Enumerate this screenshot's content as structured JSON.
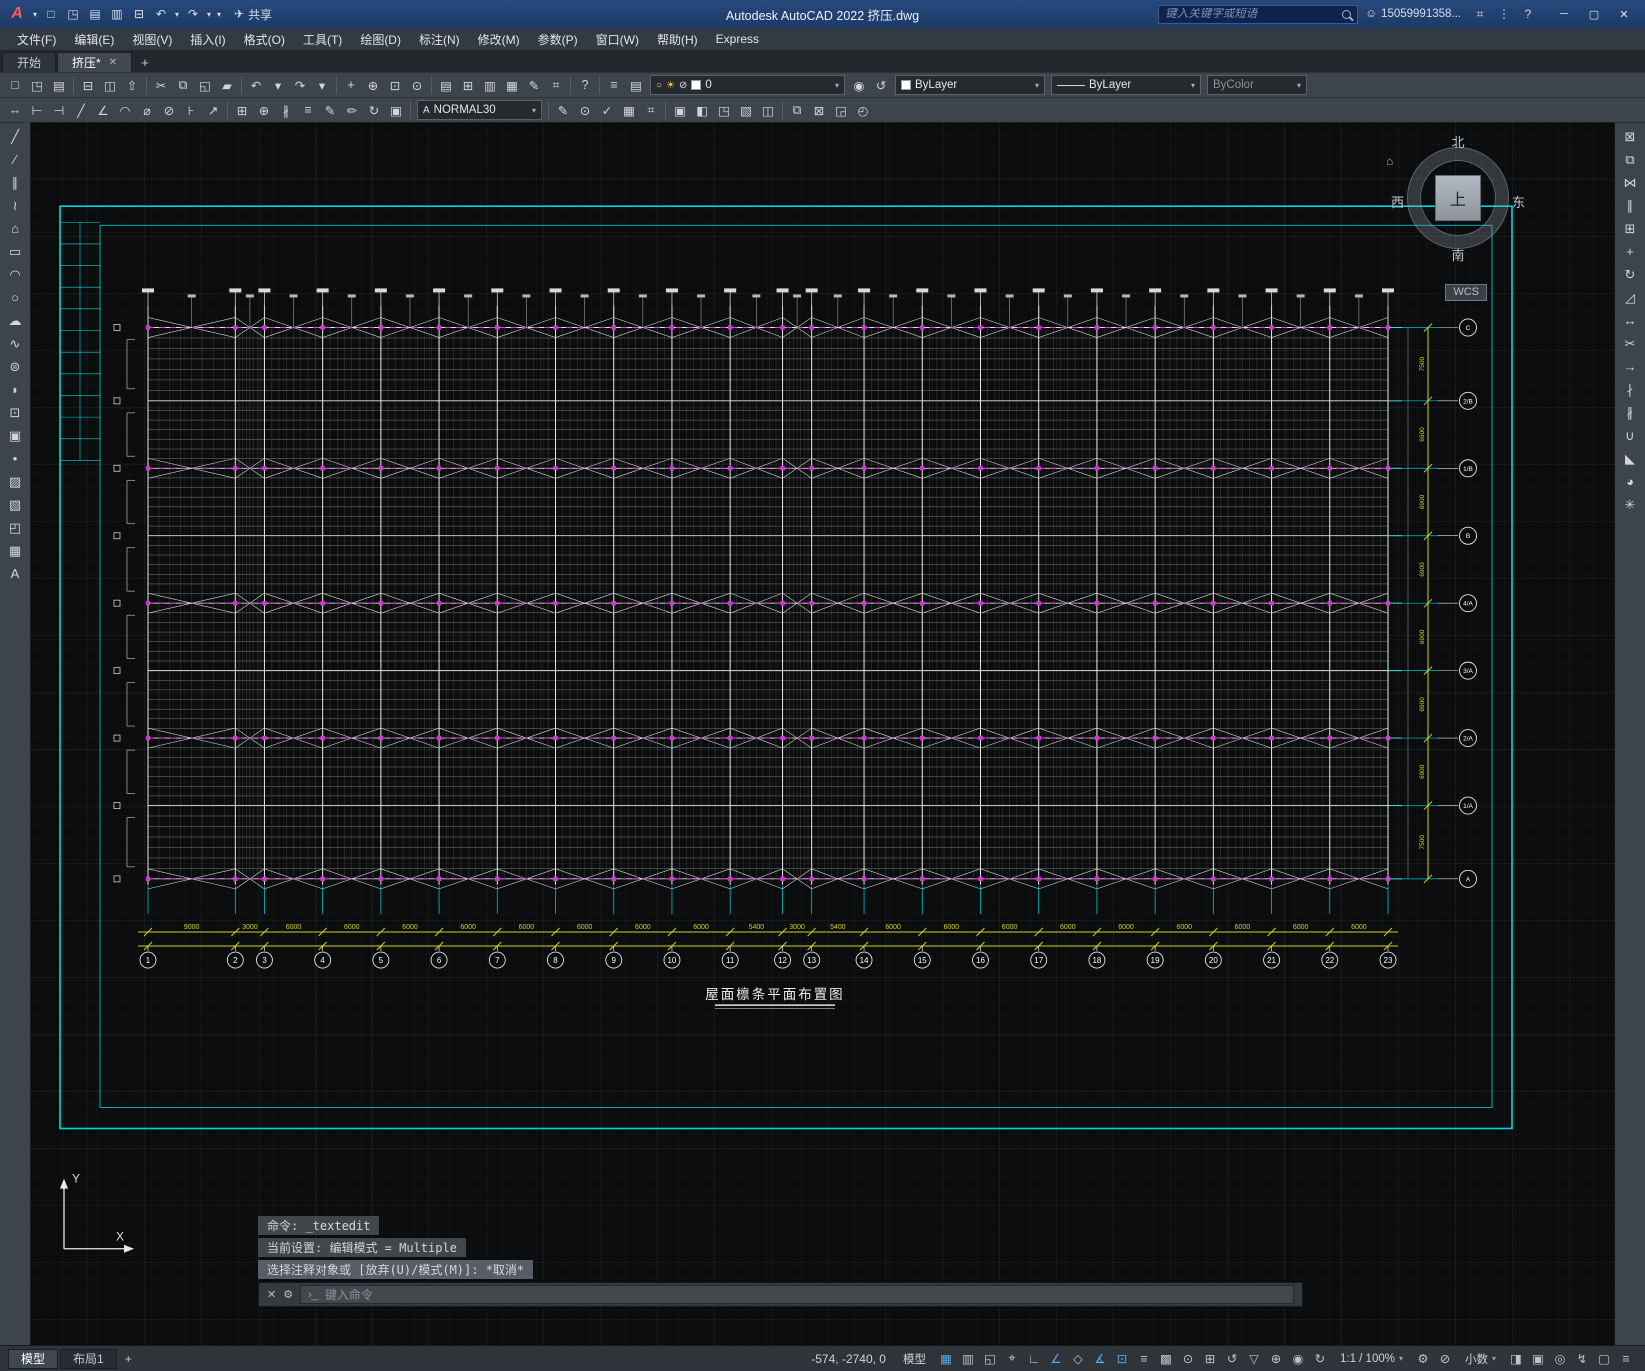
{
  "window": {
    "title": "Autodesk AutoCAD 2022   挤压.dwg",
    "search_placeholder": "键入关键字或短语",
    "user_id": "15059991358...",
    "user_glyph": "☺",
    "share_label": "共享",
    "share_glyph": "✈",
    "min_glyph": "─",
    "max_glyph": "▢",
    "close_glyph": "✕",
    "caret_glyph": "▾"
  },
  "qat": [
    {
      "n": "app-menu-caret-icon",
      "g": "▾",
      "small": 1
    },
    {
      "n": "qnew-icon",
      "g": "□"
    },
    {
      "n": "open-icon",
      "g": "◳"
    },
    {
      "n": "qsave-icon",
      "g": "▤"
    },
    {
      "n": "save-as-icon",
      "g": "▥"
    },
    {
      "n": "plot-icon",
      "g": "⊟"
    },
    {
      "n": "undo-icon",
      "g": "↶"
    },
    {
      "n": "undo-caret-icon",
      "g": "▾",
      "small": 1
    },
    {
      "n": "redo-icon",
      "g": "↷"
    },
    {
      "n": "redo-caret-icon",
      "g": "▾",
      "small": 1
    },
    {
      "n": "qat-customize-caret-icon",
      "g": "▾",
      "small": 1
    }
  ],
  "title_icons": [
    {
      "n": "cart-icon",
      "g": "⌗"
    },
    {
      "n": "apps-grid-icon",
      "g": "⋮"
    },
    {
      "n": "help-icon",
      "g": "?"
    }
  ],
  "menus": [
    "文件(F)",
    "编辑(E)",
    "视图(V)",
    "插入(I)",
    "格式(O)",
    "工具(T)",
    "绘图(D)",
    "标注(N)",
    "修改(M)",
    "参数(P)",
    "窗口(W)",
    "帮助(H)",
    "Express"
  ],
  "tabs": {
    "start": "开始",
    "drawing": "挤压*",
    "close_glyph": "✕",
    "new_glyph": "+"
  },
  "toolbars": {
    "caret": "▾",
    "row1": [
      {
        "n": "qnew-icon",
        "g": "□"
      },
      {
        "n": "open-icon",
        "g": "◳"
      },
      {
        "n": "save-icon",
        "g": "▤"
      },
      {
        "sep": 1
      },
      {
        "n": "plot-icon",
        "g": "⊟"
      },
      {
        "n": "plot-preview-icon",
        "g": "◫"
      },
      {
        "n": "publish-icon",
        "g": "⇧"
      },
      {
        "sep": 1
      },
      {
        "n": "cut-icon",
        "g": "✂"
      },
      {
        "n": "copy-icon",
        "g": "⧉"
      },
      {
        "n": "paste-icon",
        "g": "◱"
      },
      {
        "n": "match-properties-icon",
        "g": "▰"
      },
      {
        "sep": 1
      },
      {
        "n": "undo-icon",
        "g": "↶"
      },
      {
        "n": "undo-caret-icon",
        "g": "▾",
        "small": 1
      },
      {
        "n": "redo-icon",
        "g": "↷"
      },
      {
        "n": "redo-caret-icon",
        "g": "▾",
        "small": 1
      },
      {
        "sep": 1
      },
      {
        "n": "pan-icon",
        "g": "+"
      },
      {
        "n": "zoom-realtime-icon",
        "g": "⊕"
      },
      {
        "n": "zoom-window-icon",
        "g": "⊡"
      },
      {
        "n": "zoom-previous-icon",
        "g": "⊙"
      },
      {
        "sep": 1
      },
      {
        "n": "properties-icon",
        "g": "▤"
      },
      {
        "n": "designcenter-icon",
        "g": "⊞"
      },
      {
        "n": "tool-palettes-icon",
        "g": "▥"
      },
      {
        "n": "sheet-set-manager-icon",
        "g": "▦"
      },
      {
        "n": "markup-import-icon",
        "g": "✎"
      },
      {
        "n": "quick-calc-icon",
        "g": "⌗"
      },
      {
        "sep": 1
      },
      {
        "n": "help-icon",
        "g": "?"
      },
      {
        "sep": 1
      }
    ],
    "row1_layer_icons": [
      {
        "n": "layer-properties-icon",
        "g": "≡"
      },
      {
        "n": "layer-states-icon",
        "g": "▤"
      }
    ],
    "layer_combo": {
      "bulb": "○",
      "sun": "☀",
      "lock": "⊘",
      "value": "0"
    },
    "row1_layer_after": [
      {
        "n": "make-layer-current-icon",
        "g": "◉"
      },
      {
        "n": "layer-previous-icon",
        "g": "↺"
      }
    ],
    "color_value": "ByLayer",
    "linetype_value": "ByLayer",
    "plot_style": "ByColor",
    "text_style": "NORMAL30",
    "text_style_icon": "A",
    "row2a": [
      {
        "n": "measure-icon",
        "g": "↔"
      },
      {
        "n": "quick-dimension-icon",
        "g": "⊢"
      },
      {
        "n": "linear-dimension-icon",
        "g": "⊣"
      },
      {
        "n": "aligned-dimension-icon",
        "g": "╱"
      },
      {
        "n": "angular-dimension-icon",
        "g": "∠"
      },
      {
        "n": "arc-length-icon",
        "g": "◠"
      },
      {
        "n": "radius-dimension-icon",
        "g": "⌀"
      },
      {
        "n": "diameter-dimension-icon",
        "g": "⊘"
      },
      {
        "n": "ordinate-icon",
        "g": "⊦"
      },
      {
        "n": "multileader-icon",
        "g": "↗"
      },
      {
        "sep": 1
      },
      {
        "n": "tolerance-icon",
        "g": "⊞"
      },
      {
        "n": "center-mark-icon",
        "g": "⊕"
      },
      {
        "n": "dimension-break-icon",
        "g": "∦"
      },
      {
        "n": "dimension-space-icon",
        "g": "≡"
      },
      {
        "n": "dimension-edit-icon",
        "g": "✎"
      },
      {
        "n": "dimension-text-edit-icon",
        "g": "✏"
      },
      {
        "n": "dimension-update-icon",
        "g": "↻"
      },
      {
        "n": "dimension-style-icon",
        "g": "▣"
      },
      {
        "sep": 1
      }
    ],
    "row2b": [
      {
        "sep": 1
      },
      {
        "n": "single-line-text-icon",
        "g": "✎"
      },
      {
        "n": "find-replace-icon",
        "g": "⊙"
      },
      {
        "n": "spell-check-icon",
        "g": "✓"
      },
      {
        "n": "table-icon",
        "g": "▦"
      },
      {
        "n": "insert-field-icon",
        "g": "⌗"
      },
      {
        "sep": 1
      },
      {
        "n": "block-editor-icon",
        "g": "▣"
      },
      {
        "n": "define-attribute-icon",
        "g": "◧"
      },
      {
        "n": "external-reference-icon",
        "g": "◳"
      },
      {
        "n": "attach-image-icon",
        "g": "▧"
      },
      {
        "n": "ole-object-icon",
        "g": "◫"
      },
      {
        "sep": 1
      },
      {
        "n": "group-icon",
        "g": "⧉"
      },
      {
        "n": "ungroup-icon",
        "g": "⊠"
      },
      {
        "n": "bring-to-front-icon",
        "g": "◲"
      },
      {
        "n": "send-to-back-icon",
        "g": "◴"
      }
    ]
  },
  "left_toolbar": [
    {
      "n": "line-icon",
      "g": "╱"
    },
    {
      "n": "construction-line-icon",
      "g": "∕"
    },
    {
      "n": "multiline-icon",
      "g": "∥"
    },
    {
      "n": "polyline-icon",
      "g": "≀"
    },
    {
      "n": "polygon-icon",
      "g": "⌂"
    },
    {
      "n": "rectangle-icon",
      "g": "▭"
    },
    {
      "n": "arc-icon",
      "g": "◠"
    },
    {
      "n": "circle-icon",
      "g": "○"
    },
    {
      "n": "revision-cloud-icon",
      "g": "☁"
    },
    {
      "n": "spline-icon",
      "g": "∿"
    },
    {
      "n": "ellipse-icon",
      "g": "⊜"
    },
    {
      "n": "ellipse-arc-icon",
      "g": "◗"
    },
    {
      "n": "insert-block-icon",
      "g": "⊡"
    },
    {
      "n": "make-block-icon",
      "g": "▣"
    },
    {
      "n": "point-icon",
      "g": "•"
    },
    {
      "n": "hatch-icon",
      "g": "▨"
    },
    {
      "n": "gradient-icon",
      "g": "▧"
    },
    {
      "n": "region-icon",
      "g": "◰"
    },
    {
      "n": "table-icon",
      "g": "▦"
    },
    {
      "n": "mtext-icon",
      "g": "A"
    }
  ],
  "right_toolbar": [
    {
      "n": "erase-icon",
      "g": "⊠"
    },
    {
      "n": "copy-icon",
      "g": "⧉"
    },
    {
      "n": "mirror-icon",
      "g": "⋈"
    },
    {
      "n": "offset-icon",
      "g": "∥"
    },
    {
      "n": "array-icon",
      "g": "⊞"
    },
    {
      "n": "move-icon",
      "g": "+"
    },
    {
      "n": "rotate-icon",
      "g": "↻"
    },
    {
      "n": "scale-icon",
      "g": "◿"
    },
    {
      "n": "stretch-icon",
      "g": "↔"
    },
    {
      "n": "trim-icon",
      "g": "✂"
    },
    {
      "n": "extend-icon",
      "g": "→"
    },
    {
      "n": "break-at-point-icon",
      "g": "∤"
    },
    {
      "n": "break-icon",
      "g": "∦"
    },
    {
      "n": "join-icon",
      "g": "∪"
    },
    {
      "n": "chamfer-icon",
      "g": "◣"
    },
    {
      "n": "fillet-icon",
      "g": "◕"
    },
    {
      "n": "explode-icon",
      "g": "✳"
    }
  ],
  "command": {
    "history": [
      "命令: _textedit",
      "当前设置: 编辑模式 = Multiple",
      "选择注释对象或 [放弃(U)/模式(M)]: *取消*"
    ],
    "placeholder": "键入命令",
    "close_glyph": "✕",
    "tools_glyph": "⚙",
    "prompt_glyph": "›_"
  },
  "statusbar": {
    "model_tab": "模型",
    "layout_tab": "布局1",
    "new_layout_glyph": "+",
    "coords": "-574, -2740, 0",
    "model_button": "模型",
    "scale_value": "1:1 / 100%",
    "units_value": "小数",
    "icons_a": [
      {
        "n": "grid-icon",
        "g": "▦",
        "active": 1
      },
      {
        "n": "snap-icon",
        "g": "▥"
      },
      {
        "n": "infer-constraints-icon",
        "g": "◱"
      },
      {
        "n": "dynamic-input-icon",
        "g": "⌖"
      },
      {
        "n": "ortho-icon",
        "g": "∟"
      },
      {
        "n": "polar-tracking-icon",
        "g": "∠",
        "active": 1
      },
      {
        "n": "isodraft-icon",
        "g": "◇"
      },
      {
        "n": "object-snap-tracking-icon",
        "g": "∡",
        "active": 1
      },
      {
        "n": "object-snap-icon",
        "g": "⊡",
        "active": 1
      },
      {
        "n": "lineweight-icon",
        "g": "≡"
      },
      {
        "n": "transparency-icon",
        "g": "▩"
      },
      {
        "n": "selection-cycling-icon",
        "g": "⊙"
      },
      {
        "n": "object-snap-3d-icon",
        "g": "⊞"
      },
      {
        "n": "dynamic-ucs-icon",
        "g": "↺"
      },
      {
        "n": "selection-filter-icon",
        "g": "▽"
      },
      {
        "n": "gizmo-icon",
        "g": "⊕"
      },
      {
        "n": "annotation-visibility-icon",
        "g": "◉"
      },
      {
        "n": "annotation-autoscale-icon",
        "g": "↻"
      }
    ],
    "icons_b": [
      {
        "n": "workspace-gear-icon",
        "g": "⚙"
      },
      {
        "n": "annotation-monitor-icon",
        "g": "⊘"
      }
    ],
    "icons_c": [
      {
        "n": "quick-properties-icon",
        "g": "◨"
      },
      {
        "n": "lock-ui-icon",
        "g": "▣"
      },
      {
        "n": "isolate-objects-icon",
        "g": "◎"
      },
      {
        "n": "graphics-performance-icon",
        "g": "↯"
      },
      {
        "n": "clean-screen-icon",
        "g": "▢"
      },
      {
        "n": "customization-icon",
        "g": "≡"
      }
    ]
  },
  "viewcube": {
    "north": "北",
    "south": "南",
    "east": "东",
    "west": "西",
    "top": "上",
    "wcs": "WCS",
    "home_glyph": "⌂"
  },
  "drawing": {
    "title": "屋面檩条平面布置图",
    "column_labels": [
      "1",
      "2",
      "3",
      "4",
      "5",
      "6",
      "7",
      "8",
      "9",
      "10",
      "11",
      "12",
      "13",
      "14",
      "15",
      "16",
      "17",
      "18",
      "19",
      "20",
      "21",
      "22",
      "23"
    ],
    "bottom_dims": [
      "9000",
      "3000",
      "6000",
      "6000",
      "6000",
      "6000",
      "6000",
      "6000",
      "6000",
      "6000",
      "5400",
      "3000",
      "5400",
      "6000",
      "6000",
      "6000",
      "6000",
      "6000",
      "6000",
      "6000",
      "6000",
      "6000"
    ],
    "right_labels": [
      "C",
      "2/B",
      "1/B",
      "B",
      "4/A",
      "3/A",
      "2/A",
      "1/A",
      "A"
    ],
    "right_dims": [
      "7500",
      "6900",
      "6900",
      "6900",
      "6900",
      "6900",
      "6900",
      "7500"
    ],
    "colors": {
      "frame": "#00d9d9",
      "dims": "#cfcf2a",
      "accent": "#d633d6",
      "lines": "#e6e6e6"
    }
  }
}
